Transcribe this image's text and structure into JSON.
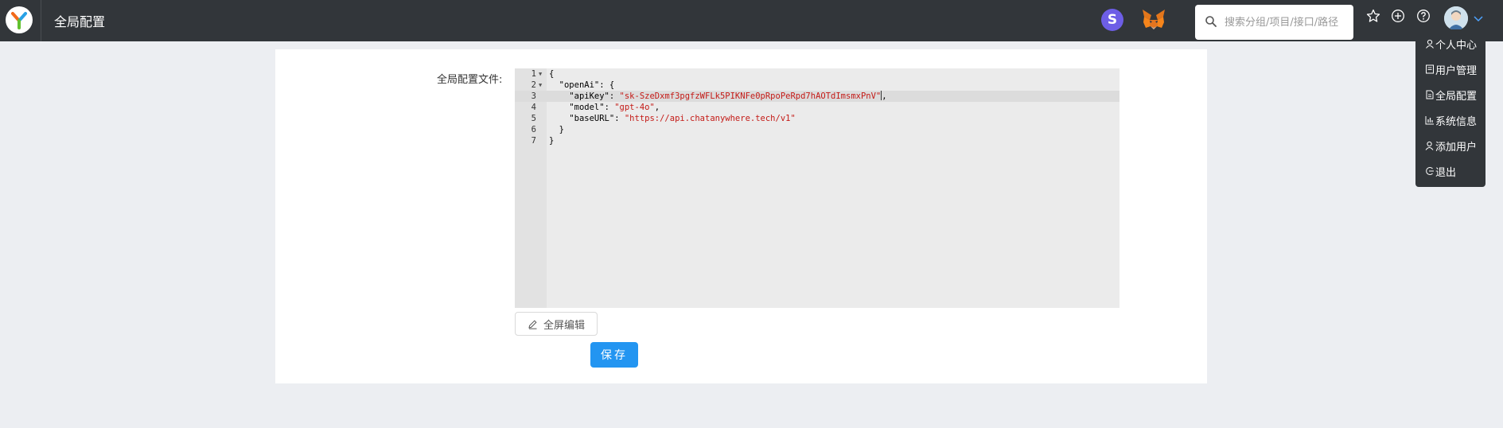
{
  "header": {
    "title": "全局配置",
    "s_badge": "S",
    "search": {
      "placeholder": "搜索分组/项目/接口/路径",
      "value": ""
    },
    "icons": [
      "star-icon",
      "plus-circle-icon",
      "question-icon"
    ]
  },
  "user_menu": {
    "items": [
      {
        "label": "个人中心",
        "icon": "user-icon"
      },
      {
        "label": "用户管理",
        "icon": "doc-icon"
      },
      {
        "label": "全局配置",
        "icon": "file-icon"
      },
      {
        "label": "系统信息",
        "icon": "bar-chart-icon"
      },
      {
        "label": "添加用户",
        "icon": "user-add-icon"
      },
      {
        "label": "退出",
        "icon": "logout-icon"
      }
    ]
  },
  "form": {
    "label": "全局配置文件:",
    "fullscreen_button": "全屏编辑",
    "save_button": "保存"
  },
  "editor": {
    "line_numbers": [
      "1",
      "2",
      "3",
      "4",
      "5",
      "6",
      "7"
    ],
    "lines": [
      {
        "prefix": "{",
        "key": "",
        "sep": "",
        "value": "",
        "suffix": ""
      },
      {
        "prefix": "  ",
        "key": "\"openAi\"",
        "sep": ": ",
        "value": "",
        "suffix": "{"
      },
      {
        "prefix": "    ",
        "key": "\"apiKey\"",
        "sep": ": ",
        "value": "\"sk-SzeDxmf3pgfzWFLk5PIKNFe0pRpoPeRpd7hAOTdImsmxPnV\"",
        "suffix": ","
      },
      {
        "prefix": "    ",
        "key": "\"model\"",
        "sep": ": ",
        "value": "\"gpt-4o\"",
        "suffix": ","
      },
      {
        "prefix": "    ",
        "key": "\"baseURL\"",
        "sep": ": ",
        "value": "\"https://api.chatanywhere.tech/v1\"",
        "suffix": ""
      },
      {
        "prefix": "  ",
        "key": "",
        "sep": "",
        "value": "",
        "suffix": "}"
      },
      {
        "prefix": "}",
        "key": "",
        "sep": "",
        "value": "",
        "suffix": ""
      }
    ]
  },
  "colors": {
    "header_bg": "#32363a",
    "accent": "#2395f1",
    "string": "#c41a16"
  }
}
